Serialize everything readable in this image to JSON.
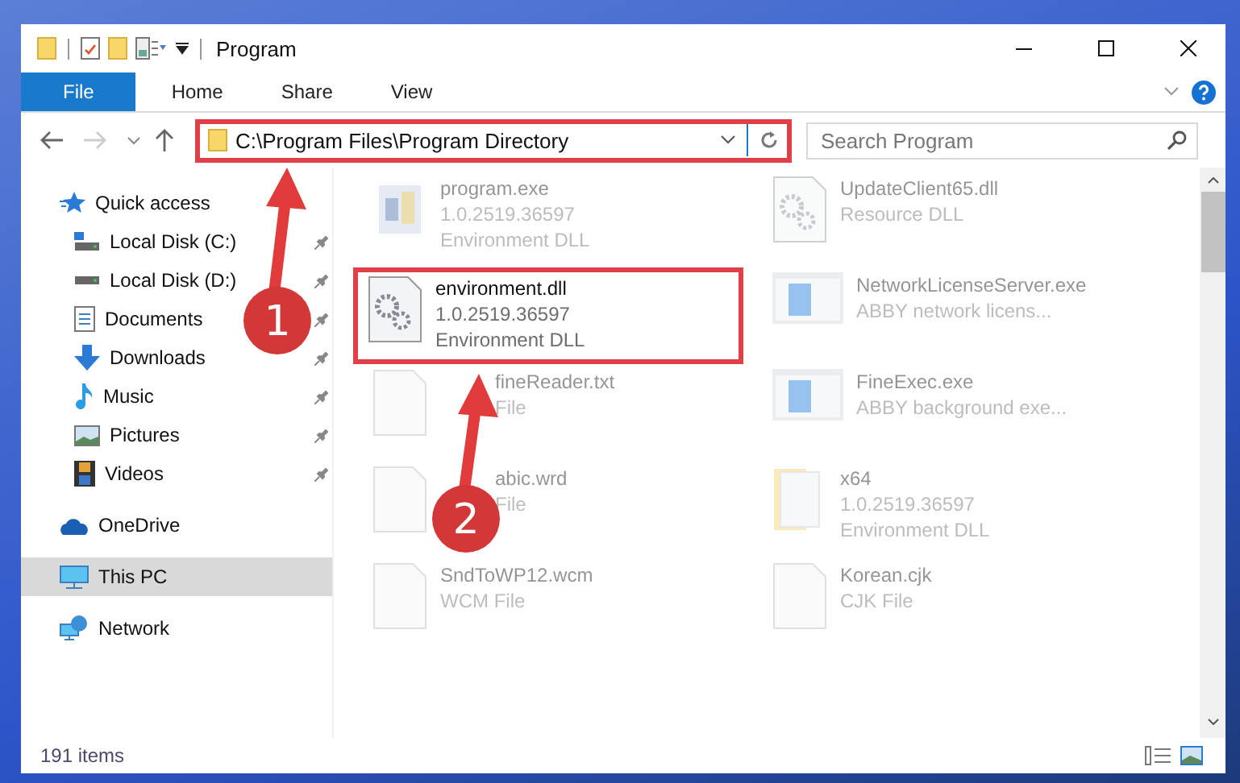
{
  "window": {
    "title": "Program"
  },
  "ribbon_tabs": [
    {
      "label": "File",
      "selected": true
    },
    {
      "label": "Home",
      "selected": false
    },
    {
      "label": "Share",
      "selected": false
    },
    {
      "label": "View",
      "selected": false
    }
  ],
  "address_bar": {
    "value": "C:\\Program Files\\Program Directory",
    "highlighted": true
  },
  "search": {
    "placeholder": "Search Program"
  },
  "sidebar": {
    "items": [
      {
        "label": "Quick access",
        "selected": false,
        "children": [
          {
            "label": "Local Disk (C:)",
            "pinned": true,
            "selected": false
          },
          {
            "label": "Local Disk (D:)",
            "pinned": true,
            "selected": false
          },
          {
            "label": "Documents",
            "pinned": true,
            "selected": false
          },
          {
            "label": "Downloads",
            "pinned": true,
            "selected": false
          },
          {
            "label": "Music",
            "pinned": true,
            "selected": false
          },
          {
            "label": "Pictures",
            "pinned": true,
            "selected": false
          },
          {
            "label": "Videos",
            "pinned": true,
            "selected": false
          }
        ]
      },
      {
        "label": "OneDrive",
        "selected": false
      },
      {
        "label": "This PC",
        "selected": true
      },
      {
        "label": "Network",
        "selected": false
      }
    ]
  },
  "files": [
    {
      "name": "program.exe",
      "lines": [
        "1.0.2519.36597",
        "Environment DLL"
      ],
      "faded": true,
      "highlighted": false
    },
    {
      "name": "UpdateClient65.dll",
      "lines": [
        "Resource DLL"
      ],
      "faded": true,
      "highlighted": false
    },
    {
      "name": "environment.dll",
      "lines": [
        "1.0.2519.36597",
        "Environment DLL"
      ],
      "faded": false,
      "highlighted": true
    },
    {
      "name": "NetworkLicenseServer.exe",
      "lines": [
        "ABBY network licens..."
      ],
      "faded": true,
      "highlighted": false
    },
    {
      "name": "fineReader.txt",
      "lines": [
        "File"
      ],
      "faded": true,
      "highlighted": false
    },
    {
      "name": "FineExec.exe",
      "lines": [
        "ABBY background exe..."
      ],
      "faded": true,
      "highlighted": false
    },
    {
      "name": "abic.wrd",
      "lines": [
        "File"
      ],
      "faded": true,
      "highlighted": false
    },
    {
      "name": "x64",
      "lines": [
        "1.0.2519.36597",
        "Environment DLL"
      ],
      "faded": true,
      "highlighted": false
    },
    {
      "name": "SndToWP12.wcm",
      "lines": [
        "WCM File"
      ],
      "faded": true,
      "highlighted": false
    },
    {
      "name": "Korean.cjk",
      "lines": [
        "CJK File"
      ],
      "faded": true,
      "highlighted": false
    }
  ],
  "status_bar": {
    "item_count": "191 items"
  },
  "annotations": [
    {
      "number": "1"
    },
    {
      "number": "2"
    }
  ]
}
